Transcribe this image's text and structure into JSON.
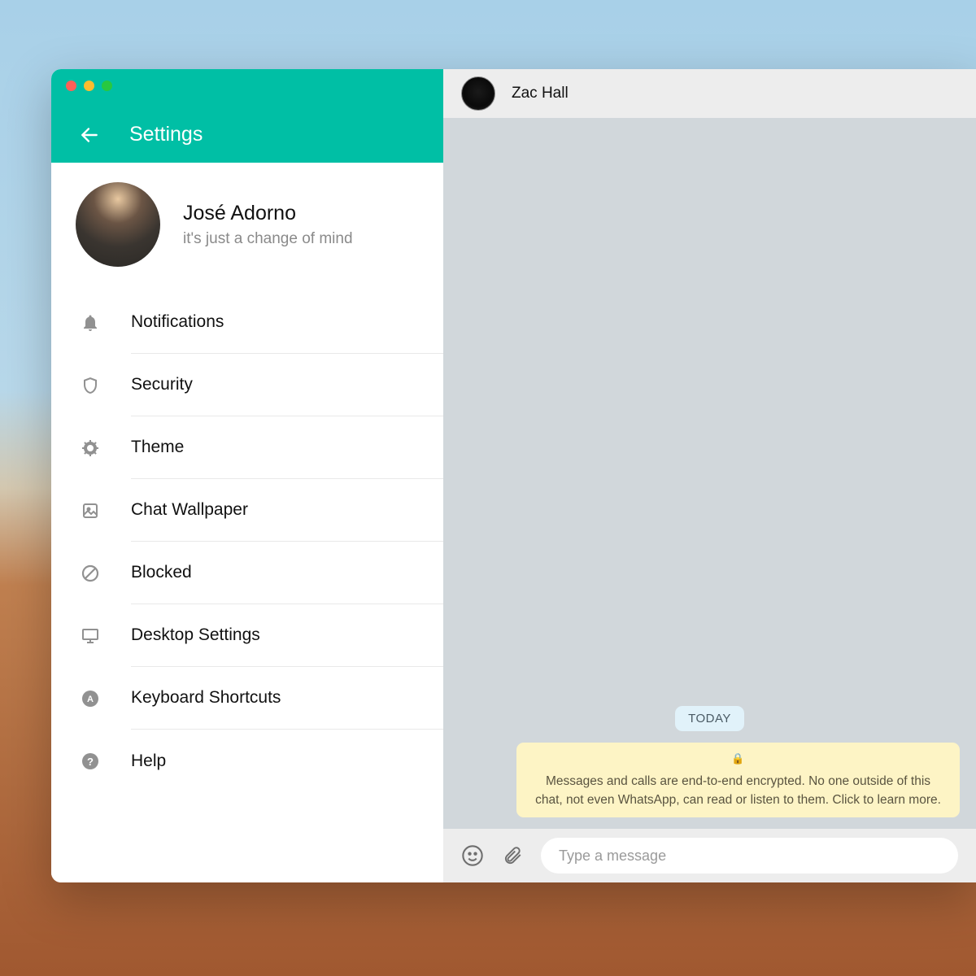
{
  "colors": {
    "accent": "#00bfa5",
    "banner_bg": "#fdf4c5",
    "date_chip_bg": "#e1f2fa"
  },
  "sidebar": {
    "title": "Settings",
    "traffic_lights": [
      "close",
      "minimize",
      "maximize"
    ],
    "profile": {
      "name": "José Adorno",
      "status": "it's just a change of mind"
    },
    "items": [
      {
        "label": "Notifications",
        "icon": "bell-icon"
      },
      {
        "label": "Security",
        "icon": "shield-icon"
      },
      {
        "label": "Theme",
        "icon": "theme-icon"
      },
      {
        "label": "Chat Wallpaper",
        "icon": "wallpaper-icon"
      },
      {
        "label": "Blocked",
        "icon": "blocked-icon"
      },
      {
        "label": "Desktop Settings",
        "icon": "desktop-icon"
      },
      {
        "label": "Keyboard Shortcuts",
        "icon": "keyboard-icon"
      },
      {
        "label": "Help",
        "icon": "help-icon"
      }
    ]
  },
  "chat": {
    "contact_name": "Zac Hall",
    "date_chip": "TODAY",
    "encryption_text": "Messages and calls are end-to-end encrypted. No one outside of this chat, not even WhatsApp, can read or listen to them. Click to learn more.",
    "input_placeholder": "Type a message"
  }
}
